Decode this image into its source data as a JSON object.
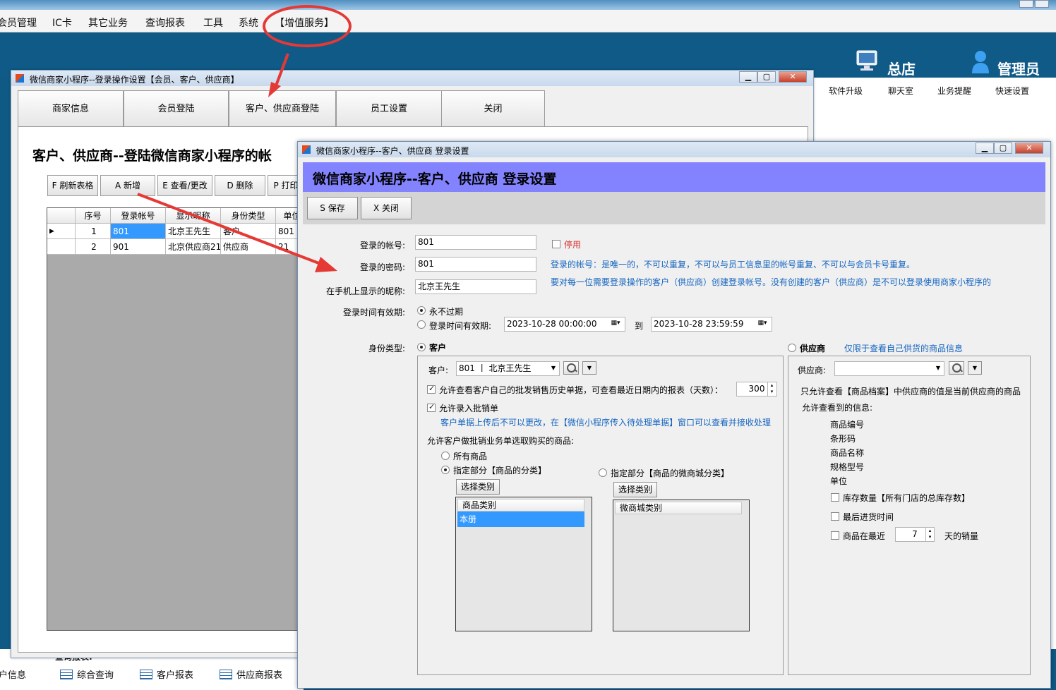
{
  "menu": [
    "会员管理",
    "IC卡",
    "其它业务",
    "查询报表",
    "工具",
    "系统",
    "【增值服务】"
  ],
  "header": {
    "store": "总店",
    "user": "管理员",
    "links": [
      "软件升级",
      "聊天室",
      "业务提醒",
      "快速设置"
    ]
  },
  "bottom": {
    "section": "查询报表:",
    "left_cut": "户信息",
    "links": [
      "综合查询",
      "客户报表",
      "供应商报表"
    ]
  },
  "win1": {
    "title": "微信商家小程序--登录操作设置【会员、客户、供应商】",
    "ctrl": {
      "min": "▁",
      "max": "▢",
      "close": "✕"
    },
    "tabs": [
      "商家信息",
      "会员登陆",
      "客户、供应商登陆",
      "员工设置",
      "关闭"
    ],
    "heading": "客户、供应商--登陆微信商家小程序的帐",
    "toolbar": [
      "F 刷新表格",
      "A 新增",
      "E 查看/更改",
      "D 删除",
      "P 打印"
    ],
    "grid": {
      "columns": [
        "序号",
        "登录帐号",
        "显示昵称",
        "身份类型",
        "单位"
      ],
      "rows": [
        [
          "1",
          "801",
          "北京王先生",
          "客户",
          "801"
        ],
        [
          "2",
          "901",
          "北京供应商21",
          "供应商",
          "21"
        ]
      ]
    }
  },
  "win2": {
    "title": "微信商家小程序--客户、供应商 登录设置",
    "ctrl": {
      "min": "▁",
      "max": "▢",
      "close": "✕"
    },
    "banner": "微信商家小程序--客户、供应商  登录设置",
    "save": "S 保存",
    "close": "X 关闭",
    "form": {
      "account_label": "登录的帐号:",
      "account_value": "801",
      "disable_label": "停用",
      "password_label": "登录的密码:",
      "password_value": "801",
      "nickname_label": "在手机上显示的昵称:",
      "nickname_value": "北京王先生",
      "note1": "登录的帐号：是唯一的，不可以重复，不可以与员工信息里的帐号重复、不可以与会员卡号重复。",
      "note2": "要对每一位需要登录操作的客户（供应商）创建登录帐号。没有创建的客户（供应商）是不可以登录使用商家小程序的",
      "validity_label": "登录时间有效期:",
      "never_expire": "永不过期",
      "valid_period": "登录时间有效期:",
      "from": "2023-10-28 00:00:00",
      "to_label": "到",
      "to": "2023-10-28 23:59:59",
      "identity_label": "身份类型:",
      "customer": "客户",
      "supplier": "供应商",
      "supplier_note": "仅限于查看自己供货的商品信息"
    },
    "customer_panel": {
      "customer_label": "客户:",
      "customer_value": "801 丨 北京王先生",
      "allow_history": "允许查看客户自己的批发销售历史单据，可查看最近日期内的报表（天数）：",
      "days": "300",
      "allow_entry": "允许录入批销单",
      "entry_note": "客户单据上传后不可以更改，在【微信小程序传入待处理单据】窗口可以查看并接收处理",
      "goods_label": "允许客户做批销业务单选取购买的商品:",
      "all_goods": "所有商品",
      "part_category": "指定部分【商品的分类】",
      "part_mall": "指定部分【商品的微商城分类】",
      "select_btn": "选择类别",
      "list1_head": "商品类别",
      "list1_item": "本册",
      "list2_head": "微商城类别"
    },
    "supplier_panel": {
      "supplier_label": "供应商:",
      "only_note": "只允许查看【商品档案】中供应商的值是当前供应商的商品",
      "visible_label": "允许查看到的信息:",
      "fields": [
        "商品编号",
        "条形码",
        "商品名称",
        "规格型号",
        "单位"
      ],
      "stock": "库存数量【所有门店的总库存数】",
      "last_in": "最后进货时间",
      "recent_prefix": "商品在最近",
      "recent_days": "7",
      "recent_suffix": "天的销量"
    }
  },
  "colors": {
    "banner": "#8383ff",
    "header": "#0f5a87",
    "annotation": "#e53935",
    "selection": "#3399ff"
  }
}
